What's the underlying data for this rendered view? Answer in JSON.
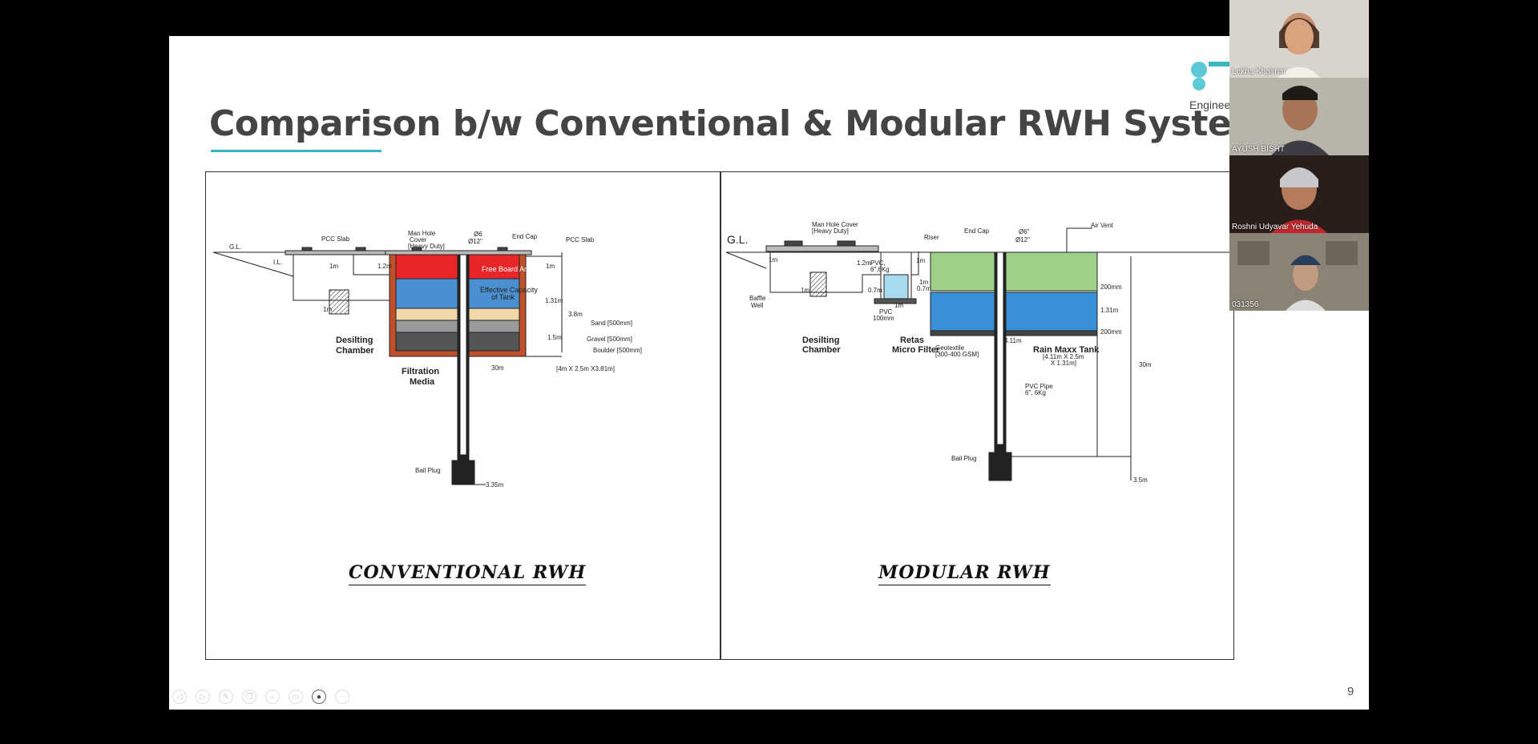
{
  "slide": {
    "title": "Comparison b/w Conventional & Modular RWH System",
    "logo_text": "Enginee",
    "page_number": "9"
  },
  "conventional": {
    "caption": "CONVENTIONAL RWH",
    "labels": {
      "gl": "G.L.",
      "il": "I.L.",
      "pcc_slab_left": "PCC Slab",
      "man_hole_1": "Man Hole",
      "man_hole_2": "Cover",
      "man_hole_3": "[Heavy Duty]",
      "phi6": "Ø6",
      "phi12": "Ø12\"",
      "end_cap": "End Cap",
      "pcc_slab_right": "PCC Slab",
      "free_board": "Free Board Area",
      "effective_1": "Effective Capacity",
      "effective_2": "of Tank",
      "sand": "Sand [500mm]",
      "gravel": "Gravel [500mm]",
      "boulder": "Boulder [500mm]",
      "dim_1m_a": "1m",
      "dim_12m": "1.2m",
      "dim_1m_b": "1m",
      "dim_1m_c": "1m",
      "dim_131m": "1.31m",
      "dim_38m": "3.8m",
      "dim_15m": "1.5m",
      "dim_30m": "30m",
      "dim_tank": "[4m X 2.5m X3.81m]",
      "desilting_1": "Desilting",
      "desilting_2": "Chamber",
      "filtration_1": "Filtration",
      "filtration_2": "Media",
      "bail_plug": "Bail Plug",
      "dim_335m": "3.35m"
    }
  },
  "modular": {
    "caption": "MODULAR RWH",
    "labels": {
      "gl": "G.L.",
      "man_hole_1": "Man Hole Cover",
      "man_hole_2": "[Heavy Duty]",
      "riser": "Riser",
      "end_cap": "End Cap",
      "phi6": "Ø6\"",
      "phi12": "Ø12\"",
      "air_vent": "Air Vent",
      "dim_1m_a": "1m",
      "dim_12m": "1.2m",
      "pvc_1": "PVC,",
      "pvc_2": "6\",6Kg",
      "dim_1m_b": "1m",
      "dim_07m_a": "0.7m",
      "dim_1m_c": "1m",
      "dim_07m_b": "0.7m",
      "dim_200_top": "200mm",
      "dim_131m": "1.31m",
      "dim_200_bot": "200mm",
      "baffle_1": "Baffle",
      "baffle_2": "Well",
      "dim_1m_d": "1m",
      "pvc100_1": "PVC",
      "pvc100_2": "100mm",
      "dim_1m_e": "1m",
      "dim_411m": "4.11m",
      "desilting_1": "Desilting",
      "desilting_2": "Chamber",
      "retas_1": "Retas",
      "retas_2": "Micro Filter",
      "geotextile_1": "Geotextile",
      "geotextile_2": "[300-400 GSM]",
      "rain_maxx": "Rain Maxx Tank",
      "rain_dim_1": "[4.11m X 2.5m",
      "rain_dim_2": "X 1.31m]",
      "dim_30m": "30m",
      "pvc_pipe_1": "PVC Pipe",
      "pvc_pipe_2": "6\", 6Kg",
      "bail_plug": "Bail Plug",
      "dim_35m": "3.5m"
    }
  },
  "participants": [
    {
      "name": "Lekha Khairnar"
    },
    {
      "name": "AYUSH BISHT"
    },
    {
      "name": "Roshni Udyavar Yehuda"
    },
    {
      "name": "031356"
    }
  ],
  "toolbar": {
    "icons": [
      "prev-icon",
      "next-icon",
      "pen-icon",
      "copy-icon",
      "zoom-icon",
      "subtitle-icon",
      "camera-icon",
      "more-icon"
    ]
  },
  "colors": {
    "accent": "#3ab6c2",
    "free_board": "#e8262a",
    "water": "#4a90d0",
    "sand": "#f2d8a8",
    "brick": "#c0502a",
    "green_fill": "#9fd08a",
    "tank_blue": "#3a8fd6"
  }
}
